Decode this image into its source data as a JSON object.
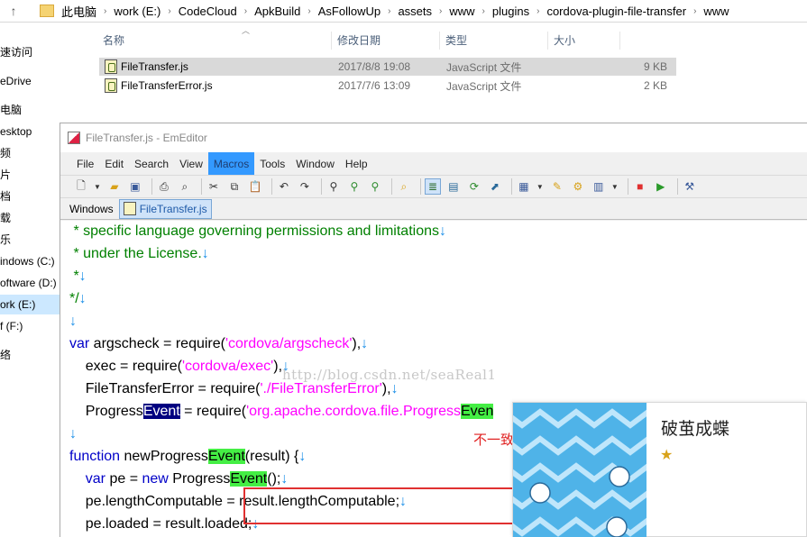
{
  "explorer": {
    "breadcrumbs": [
      "此电脑",
      "work (E:)",
      "CodeCloud",
      "ApkBuild",
      "AsFollowUp",
      "assets",
      "www",
      "plugins",
      "cordova-plugin-file-transfer",
      "www"
    ],
    "nav_items": [
      {
        "label": "速访问",
        "selected": false
      },
      {
        "label": "eDrive",
        "selected": false
      },
      {
        "label": "电脑",
        "selected": false
      },
      {
        "label": "esktop",
        "selected": false
      },
      {
        "label": "频",
        "selected": false
      },
      {
        "label": "片",
        "selected": false
      },
      {
        "label": "档",
        "selected": false
      },
      {
        "label": "载",
        "selected": false
      },
      {
        "label": "乐",
        "selected": false
      },
      {
        "label": "indows (C:)",
        "selected": false
      },
      {
        "label": "oftware (D:)",
        "selected": false
      },
      {
        "label": "ork (E:)",
        "selected": true
      },
      {
        "label": "f (F:)",
        "selected": false
      },
      {
        "label": "络",
        "selected": false
      }
    ],
    "columns": {
      "name": "名称",
      "modified": "修改日期",
      "type": "类型",
      "size": "大小"
    },
    "files": [
      {
        "name": "FileTransfer.js",
        "modified": "2017/8/8 19:08",
        "type": "JavaScript 文件",
        "size": "9 KB",
        "selected": true
      },
      {
        "name": "FileTransferError.js",
        "modified": "2017/7/6 13:09",
        "type": "JavaScript 文件",
        "size": "2 KB",
        "selected": false
      }
    ]
  },
  "editor": {
    "title": "FileTransfer.js - EmEditor",
    "menu": [
      "File",
      "Edit",
      "Search",
      "View",
      "Macros",
      "Tools",
      "Window",
      "Help"
    ],
    "active_menu": "Macros",
    "tab_bar_label": "Windows",
    "active_tab": "FileTransfer.js",
    "newline_glyph": "↓",
    "code": {
      "l1": " * specific language governing permissions and limitations",
      "l2": " * under the License.",
      "l3": " *",
      "l4": "*/",
      "l6_kw": "var",
      "l6_a": " argscheck = require(",
      "l6_s": "'cordova/argscheck'",
      "l6_b": "),",
      "l7_a": "    exec = require(",
      "l7_s": "'cordova/exec'",
      "l7_b": "),",
      "l8_a": "    FileTransferError = require(",
      "l8_s": "'./FileTransferError'",
      "l8_b": "),",
      "l9_a": "    Progress",
      "l9_sel": "Event",
      "l9_b": " = require(",
      "l9_s": "'org.apache.cordova.file.Progress",
      "l9_hl": "Even",
      "l11_kw": "function",
      "l11_a": " newProgress",
      "l11_hl": "Event",
      "l11_b": "(result) {",
      "l12_a": "    ",
      "l12_kw1": "var",
      "l12_b": " pe = ",
      "l12_kw2": "new",
      "l12_c": " Progress",
      "l12_hl": "Event",
      "l12_d": "();",
      "l13": "    pe.lengthComputable = result.lengthComputable;",
      "l14": "    pe.loaded = result.loaded;"
    },
    "watermark": "http://blog.csdn.net/seaReal1",
    "annotation": "不一致，可能是版本升级的原因吧"
  },
  "popup": {
    "title": "破茧成蝶",
    "star": "★"
  },
  "colors": {
    "comment": "#008000",
    "keyword": "#0000c8",
    "string": "#ff00ff",
    "match_highlight": "#44ee44",
    "selection": "#000080",
    "annotation": "#e02020",
    "menu_hot": "#3399ff"
  }
}
